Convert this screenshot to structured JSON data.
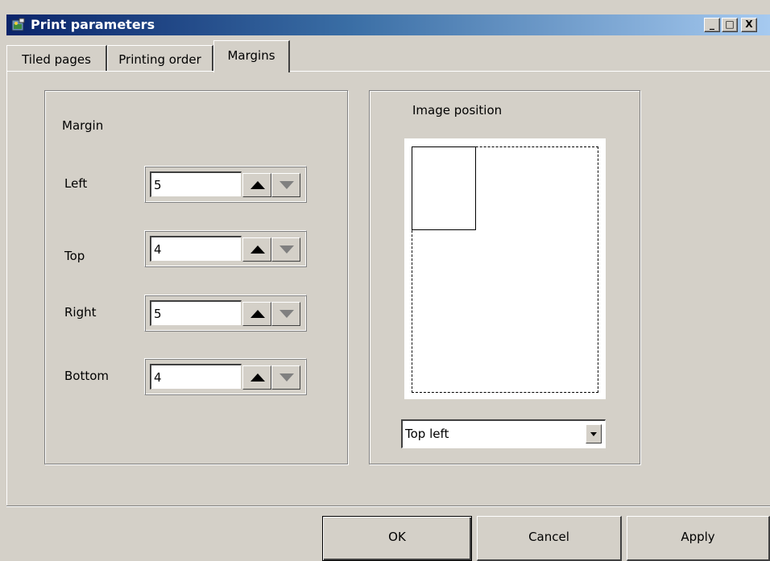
{
  "window": {
    "title": "Print parameters",
    "minimize_glyph": "_",
    "maximize_glyph": "□",
    "close_glyph": "X"
  },
  "tabs": [
    {
      "label": "Tiled pages",
      "active": false
    },
    {
      "label": "Printing order",
      "active": false
    },
    {
      "label": "Margins",
      "active": true
    }
  ],
  "margin_group": {
    "title": "Margin",
    "fields": [
      {
        "label": "Left",
        "value": "5"
      },
      {
        "label": "Top",
        "value": "4"
      },
      {
        "label": "Right",
        "value": "5"
      },
      {
        "label": "Bottom",
        "value": "4"
      }
    ]
  },
  "image_group": {
    "title": "Image position",
    "selected_position": "Top left"
  },
  "buttons": {
    "ok": "OK",
    "cancel": "Cancel",
    "apply": "Apply"
  },
  "icons": {
    "app": "print-parameters-app-icon",
    "spin_up": "triangle-up-icon",
    "spin_down": "triangle-down-icon",
    "dropdown": "chevron-down-icon"
  },
  "colors": {
    "face": "#d4d0c8",
    "titlebar_start": "#0a246a",
    "titlebar_end": "#a6caf0"
  }
}
